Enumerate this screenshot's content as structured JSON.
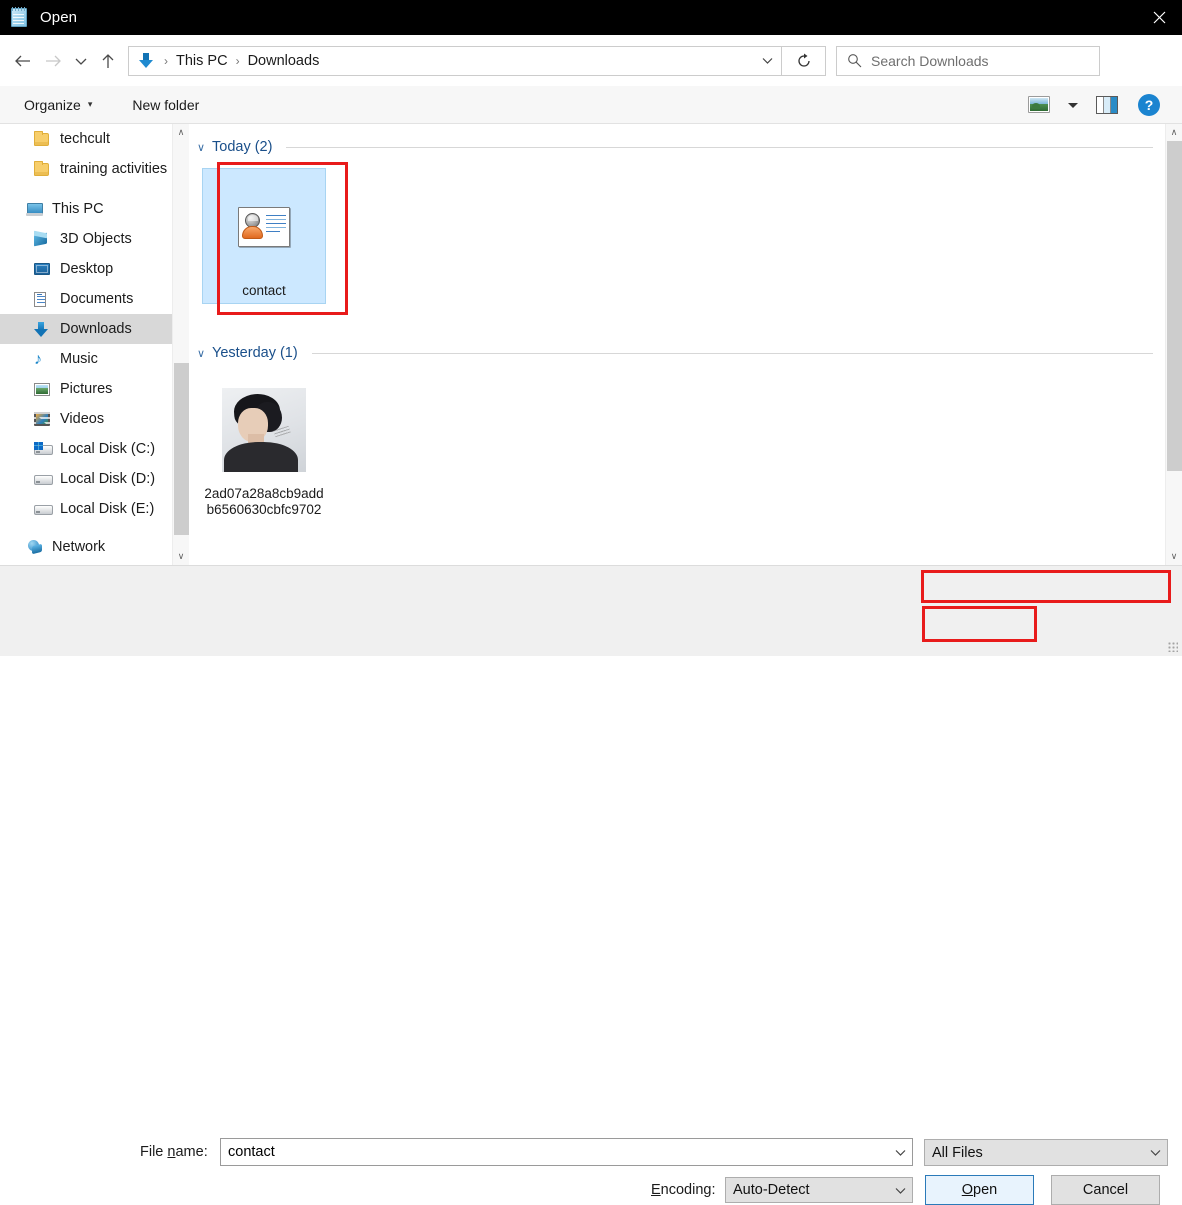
{
  "window": {
    "title": "Open",
    "app_icon": "notepad-icon",
    "close_label": "✕"
  },
  "nav": {
    "back_icon": "back-arrow-icon",
    "forward_icon": "forward-arrow-icon",
    "recent_icon": "chevron-down-icon",
    "up_icon": "up-arrow-icon",
    "address": {
      "location_icon": "downloads-arrow-icon",
      "crumbs": [
        "This PC",
        "Downloads"
      ],
      "separator": "›",
      "dropdown_icon": "chevron-down-icon"
    },
    "refresh_icon": "refresh-icon",
    "search": {
      "icon": "search-icon",
      "placeholder": "Search Downloads",
      "value": ""
    }
  },
  "command_bar": {
    "organize_label": "Organize",
    "organize_caret": "▾",
    "new_folder_label": "New folder",
    "view_icon": "view-mode-icon",
    "view_caret": "▾",
    "preview_pane_icon": "preview-pane-icon",
    "help_icon": "help-icon",
    "help_label": "?"
  },
  "sidebar": {
    "items": [
      {
        "label": "techcult",
        "icon": "folder-icon",
        "indent": true,
        "selected": false
      },
      {
        "label": "training activities",
        "icon": "folder-icon",
        "indent": true,
        "selected": false
      },
      {
        "label": "This PC",
        "icon": "this-pc-icon",
        "indent": false,
        "selected": false
      },
      {
        "label": "3D Objects",
        "icon": "3d-objects-icon",
        "indent": true,
        "selected": false
      },
      {
        "label": "Desktop",
        "icon": "desktop-icon",
        "indent": true,
        "selected": false
      },
      {
        "label": "Documents",
        "icon": "documents-icon",
        "indent": true,
        "selected": false
      },
      {
        "label": "Downloads",
        "icon": "downloads-icon",
        "indent": true,
        "selected": true
      },
      {
        "label": "Music",
        "icon": "music-icon",
        "indent": true,
        "selected": false
      },
      {
        "label": "Pictures",
        "icon": "pictures-icon",
        "indent": true,
        "selected": false
      },
      {
        "label": "Videos",
        "icon": "videos-icon",
        "indent": true,
        "selected": false
      },
      {
        "label": "Local Disk (C:)",
        "icon": "windows-drive-icon",
        "indent": true,
        "selected": false
      },
      {
        "label": "Local Disk (D:)",
        "icon": "drive-icon",
        "indent": true,
        "selected": false
      },
      {
        "label": "Local Disk (E:)",
        "icon": "drive-icon",
        "indent": true,
        "selected": false
      },
      {
        "label": "Network",
        "icon": "network-icon",
        "indent": false,
        "selected": false
      }
    ],
    "scroll_up_icon": "∧",
    "scroll_down_icon": "∨"
  },
  "file_list": {
    "groups": [
      {
        "title": "Today (2)",
        "chevron": "∨",
        "items": [
          {
            "label": "contact",
            "thumb": "contact-card-icon",
            "selected": true,
            "highlighted": true
          }
        ]
      },
      {
        "title": "Yesterday (1)",
        "chevron": "∨",
        "items": [
          {
            "label": "2ad07a28a8cb9addb6560630cbfc9702",
            "thumb": "photo-thumbnail",
            "selected": false,
            "highlighted": false
          }
        ]
      }
    ],
    "scroll_up_icon": "∧",
    "scroll_down_icon": "∨"
  },
  "footer": {
    "file_name_label_pre": "File ",
    "file_name_label_key": "n",
    "file_name_label_post": "ame:",
    "file_name_value": "contact",
    "file_name_placeholder": "File name",
    "file_name_chevron": "∨",
    "filter_value": "All Files",
    "filter_chevron": "∨",
    "encoding_label_key": "E",
    "encoding_label_post": "ncoding:",
    "encoding_value": "Auto-Detect",
    "encoding_chevron": "∨",
    "open_label_key": "O",
    "open_label_post": "pen",
    "cancel_label": "Cancel"
  },
  "annotations": {
    "highlight_color": "#e81b1b",
    "boxes": [
      "contact-file-tile",
      "file-type-filter",
      "open-button"
    ]
  },
  "colors": {
    "titlebar_bg": "#000000",
    "selection_blue": "#cce8ff",
    "group_header_blue": "#1a4f8a",
    "accent": "#1b84d0"
  }
}
